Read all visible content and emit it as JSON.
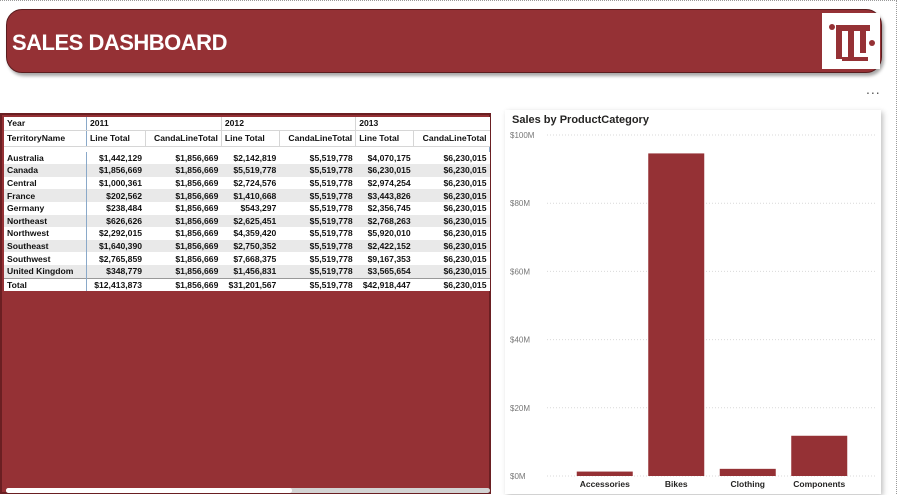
{
  "header": {
    "title": "SALES DASHBOARD",
    "logo_text": "iti"
  },
  "more_options": "...",
  "matrix": {
    "year_label": "Year",
    "territory_label": "TerritoryName",
    "years": [
      "2011",
      "2012",
      "2013"
    ],
    "columns": [
      "Line Total",
      "CandaLineTotal",
      "Line Total",
      "CandaLineTotal",
      "Line Total",
      "CandaLineTotal"
    ],
    "rows": [
      {
        "name": "Australia",
        "values": [
          "$1,442,129",
          "$1,856,669",
          "$2,142,819",
          "$5,519,778",
          "$4,070,175",
          "$6,230,015"
        ]
      },
      {
        "name": "Canada",
        "values": [
          "$1,856,669",
          "$1,856,669",
          "$5,519,778",
          "$5,519,778",
          "$6,230,015",
          "$6,230,015"
        ]
      },
      {
        "name": "Central",
        "values": [
          "$1,000,361",
          "$1,856,669",
          "$2,724,576",
          "$5,519,778",
          "$2,974,254",
          "$6,230,015"
        ]
      },
      {
        "name": "France",
        "values": [
          "$202,562",
          "$1,856,669",
          "$1,410,668",
          "$5,519,778",
          "$3,443,826",
          "$6,230,015"
        ]
      },
      {
        "name": "Germany",
        "values": [
          "$238,484",
          "$1,856,669",
          "$543,297",
          "$5,519,778",
          "$2,356,745",
          "$6,230,015"
        ]
      },
      {
        "name": "Northeast",
        "values": [
          "$626,626",
          "$1,856,669",
          "$2,625,451",
          "$5,519,778",
          "$2,768,263",
          "$6,230,015"
        ]
      },
      {
        "name": "Northwest",
        "values": [
          "$2,292,015",
          "$1,856,669",
          "$4,359,420",
          "$5,519,778",
          "$5,920,010",
          "$6,230,015"
        ]
      },
      {
        "name": "Southeast",
        "values": [
          "$1,640,390",
          "$1,856,669",
          "$2,750,352",
          "$5,519,778",
          "$2,422,152",
          "$6,230,015"
        ]
      },
      {
        "name": "Southwest",
        "values": [
          "$2,765,859",
          "$1,856,669",
          "$7,668,375",
          "$5,519,778",
          "$9,167,353",
          "$6,230,015"
        ]
      },
      {
        "name": "United Kingdom",
        "values": [
          "$348,779",
          "$1,856,669",
          "$1,456,831",
          "$5,519,778",
          "$3,565,654",
          "$6,230,015"
        ]
      }
    ],
    "total": {
      "name": "Total",
      "values": [
        "$12,413,873",
        "$1,856,669",
        "$31,201,567",
        "$5,519,778",
        "$42,918,447",
        "$6,230,015"
      ]
    }
  },
  "chart_data": {
    "type": "bar",
    "title": "Sales by ProductCategory",
    "categories": [
      "Accessories",
      "Bikes",
      "Clothing",
      "Components"
    ],
    "values": [
      1.3,
      94.6,
      2.1,
      11.8
    ],
    "unit": "M",
    "ylim": [
      0,
      100
    ],
    "yticks": [
      "$0M",
      "$20M",
      "$40M",
      "$60M",
      "$80M",
      "$100M"
    ],
    "grid": true,
    "bar_color": "#953135"
  },
  "colors": {
    "brand": "#953135",
    "header_text": "#ffffff"
  }
}
